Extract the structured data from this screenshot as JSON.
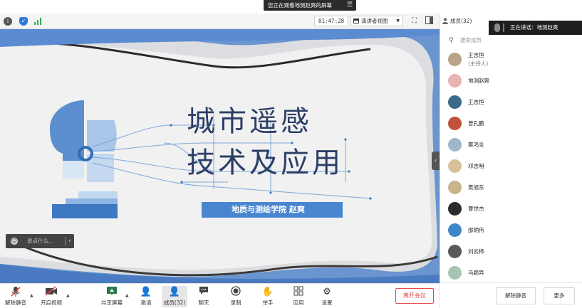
{
  "banner": {
    "text": "您正在观看地测赵爽的屏幕"
  },
  "video_toolbar": {
    "timer": "01:47:28",
    "view_mode": "演讲者视图"
  },
  "slide": {
    "title_line1": "城市遥感",
    "title_line2": "技术及应用",
    "subtitle": "地质与测绘学院  赵爽",
    "comment_placeholder": "说点什么..."
  },
  "bottom_bar": {
    "items": [
      {
        "label": "解除静音"
      },
      {
        "label": "开启视频"
      },
      {
        "label": "共享屏幕"
      },
      {
        "label": "邀请"
      },
      {
        "label": "成员(32)"
      },
      {
        "label": "聊天"
      },
      {
        "label": "录制"
      },
      {
        "label": "举手"
      },
      {
        "label": "应用"
      },
      {
        "label": "设置"
      }
    ],
    "leave_label": "离开会议"
  },
  "panel": {
    "title": "成员(32)",
    "speaking": "正在讲话：地测赵爽",
    "search_placeholder": "搜索成员",
    "members": [
      {
        "name": "王志恒",
        "role": "(主持人)",
        "avatar_color": "#b9a48a"
      },
      {
        "name": "地测赵爽",
        "role": "",
        "avatar_color": "#e8b3b3"
      },
      {
        "name": "王志恒",
        "role": "",
        "avatar_color": "#3b6b8c"
      },
      {
        "name": "曾孔鹏",
        "role": "",
        "avatar_color": "#c0533a"
      },
      {
        "name": "樊鸿全",
        "role": "",
        "avatar_color": "#9fb7c9"
      },
      {
        "name": "邓志明",
        "role": "",
        "avatar_color": "#d8c19a"
      },
      {
        "name": "黄旭东",
        "role": "",
        "avatar_color": "#c9b58c"
      },
      {
        "name": "曹世杰",
        "role": "",
        "avatar_color": "#2c2c2c"
      },
      {
        "name": "邵炳伟",
        "role": "",
        "avatar_color": "#3f86c9"
      },
      {
        "name": "刘云柿",
        "role": "",
        "avatar_color": "#5a5a5a"
      },
      {
        "name": "马颖异",
        "role": "",
        "avatar_color": "#a7c4b0"
      }
    ],
    "unmute_all": "解除静音",
    "more": "更多"
  },
  "colors": {
    "accent_blue": "#4a86cf",
    "leave_red": "#e24a4a",
    "title_navy": "#2b3f66"
  }
}
